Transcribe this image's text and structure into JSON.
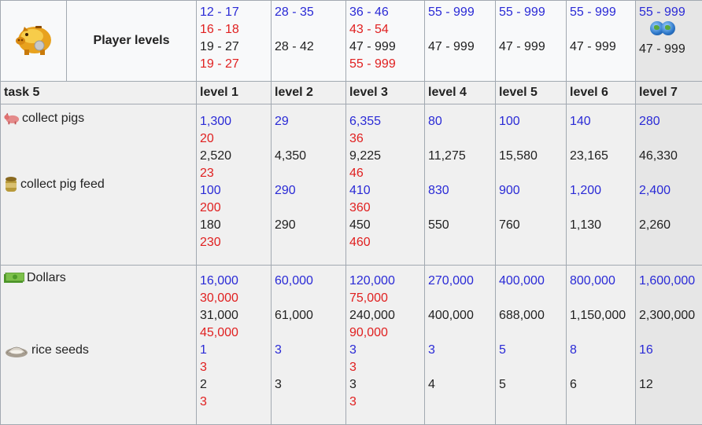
{
  "header": {
    "player_levels_label": "Player levels",
    "columns": [
      {
        "lines": [
          {
            "t": "12 - 17",
            "c": "blue"
          },
          {
            "t": "16 - 18",
            "c": "red"
          },
          {
            "t": "19 - 27",
            "c": "black"
          },
          {
            "t": "19 - 27",
            "c": "red"
          }
        ]
      },
      {
        "lines": [
          {
            "t": "28 - 35",
            "c": "blue"
          },
          {
            "t": "",
            "c": "gap"
          },
          {
            "t": "28 - 42",
            "c": "black"
          }
        ]
      },
      {
        "lines": [
          {
            "t": "36 - 46",
            "c": "blue"
          },
          {
            "t": "43 - 54",
            "c": "red"
          },
          {
            "t": "47 - 999",
            "c": "black"
          },
          {
            "t": "55 - 999",
            "c": "red"
          }
        ]
      },
      {
        "lines": [
          {
            "t": "55 - 999",
            "c": "blue"
          },
          {
            "t": "",
            "c": "gap"
          },
          {
            "t": "47 - 999",
            "c": "black"
          }
        ]
      },
      {
        "lines": [
          {
            "t": "55 - 999",
            "c": "blue"
          },
          {
            "t": "",
            "c": "gap"
          },
          {
            "t": "47 - 999",
            "c": "black"
          }
        ]
      },
      {
        "lines": [
          {
            "t": "55 - 999",
            "c": "blue"
          },
          {
            "t": "",
            "c": "gap"
          },
          {
            "t": "47 - 999",
            "c": "black"
          }
        ]
      },
      {
        "lines": [
          {
            "t": "55 - 999",
            "c": "blue"
          },
          {
            "t": "globe",
            "c": "globe"
          },
          {
            "t": "47 - 999",
            "c": "black"
          }
        ]
      }
    ]
  },
  "levels_row": {
    "task_label": "task 5",
    "levels": [
      "level 1",
      "level 2",
      "level 3",
      "level 4",
      "level 5",
      "level 6",
      "level 7"
    ]
  },
  "section_a": {
    "items": [
      {
        "label": "collect pigs",
        "icon": "pig-icon"
      },
      {
        "label": "collect pig feed",
        "icon": "pig-feed-icon"
      }
    ],
    "columns": [
      [
        {
          "t": "1,300",
          "c": "blue"
        },
        {
          "t": "20",
          "c": "red"
        },
        {
          "t": "2,520",
          "c": "black"
        },
        {
          "t": "23",
          "c": "red"
        },
        {
          "t": "100",
          "c": "blue"
        },
        {
          "t": "200",
          "c": "red"
        },
        {
          "t": "180",
          "c": "black"
        },
        {
          "t": "230",
          "c": "red"
        }
      ],
      [
        {
          "t": "29",
          "c": "blue"
        },
        {
          "t": "",
          "c": "gap"
        },
        {
          "t": "4,350",
          "c": "black"
        },
        {
          "t": "",
          "c": "gap"
        },
        {
          "t": "290",
          "c": "blue"
        },
        {
          "t": "",
          "c": "gap"
        },
        {
          "t": "290",
          "c": "black"
        }
      ],
      [
        {
          "t": "6,355",
          "c": "blue"
        },
        {
          "t": "36",
          "c": "red"
        },
        {
          "t": "9,225",
          "c": "black"
        },
        {
          "t": "46",
          "c": "red"
        },
        {
          "t": "410",
          "c": "blue"
        },
        {
          "t": "360",
          "c": "red"
        },
        {
          "t": "450",
          "c": "black"
        },
        {
          "t": "460",
          "c": "red"
        }
      ],
      [
        {
          "t": "80",
          "c": "blue"
        },
        {
          "t": "",
          "c": "gap"
        },
        {
          "t": "11,275",
          "c": "black"
        },
        {
          "t": "",
          "c": "gap"
        },
        {
          "t": "830",
          "c": "blue"
        },
        {
          "t": "",
          "c": "gap"
        },
        {
          "t": "550",
          "c": "black"
        }
      ],
      [
        {
          "t": "100",
          "c": "blue"
        },
        {
          "t": "",
          "c": "gap"
        },
        {
          "t": "15,580",
          "c": "black"
        },
        {
          "t": "",
          "c": "gap"
        },
        {
          "t": "900",
          "c": "blue"
        },
        {
          "t": "",
          "c": "gap"
        },
        {
          "t": "760",
          "c": "black"
        }
      ],
      [
        {
          "t": "140",
          "c": "blue"
        },
        {
          "t": "",
          "c": "gap"
        },
        {
          "t": "23,165",
          "c": "black"
        },
        {
          "t": "",
          "c": "gap"
        },
        {
          "t": "1,200",
          "c": "blue"
        },
        {
          "t": "",
          "c": "gap"
        },
        {
          "t": "1,130",
          "c": "black"
        }
      ],
      [
        {
          "t": "280",
          "c": "blue"
        },
        {
          "t": "",
          "c": "gap"
        },
        {
          "t": "46,330",
          "c": "black"
        },
        {
          "t": "",
          "c": "gap"
        },
        {
          "t": "2,400",
          "c": "blue"
        },
        {
          "t": "",
          "c": "gap"
        },
        {
          "t": "2,260",
          "c": "black"
        }
      ]
    ]
  },
  "section_b": {
    "items": [
      {
        "label": "Dollars",
        "icon": "dollar-icon"
      },
      {
        "label": "rice seeds",
        "icon": "rice-seeds-icon"
      }
    ],
    "columns": [
      [
        {
          "t": "16,000",
          "c": "blue"
        },
        {
          "t": "30,000",
          "c": "red"
        },
        {
          "t": "31,000",
          "c": "black"
        },
        {
          "t": "45,000",
          "c": "red"
        },
        {
          "t": "1",
          "c": "blue"
        },
        {
          "t": "3",
          "c": "red"
        },
        {
          "t": "2",
          "c": "black"
        },
        {
          "t": "3",
          "c": "red"
        }
      ],
      [
        {
          "t": "60,000",
          "c": "blue"
        },
        {
          "t": "",
          "c": "gap"
        },
        {
          "t": "61,000",
          "c": "black"
        },
        {
          "t": "",
          "c": "gap"
        },
        {
          "t": "3",
          "c": "blue"
        },
        {
          "t": "",
          "c": "gap"
        },
        {
          "t": "3",
          "c": "black"
        }
      ],
      [
        {
          "t": "120,000",
          "c": "blue"
        },
        {
          "t": "75,000",
          "c": "red"
        },
        {
          "t": "240,000",
          "c": "black"
        },
        {
          "t": "90,000",
          "c": "red"
        },
        {
          "t": "3",
          "c": "blue"
        },
        {
          "t": "3",
          "c": "red"
        },
        {
          "t": "3",
          "c": "black"
        },
        {
          "t": "3",
          "c": "red"
        }
      ],
      [
        {
          "t": "270,000",
          "c": "blue"
        },
        {
          "t": "",
          "c": "gap"
        },
        {
          "t": "400,000",
          "c": "black"
        },
        {
          "t": "",
          "c": "gap"
        },
        {
          "t": "3",
          "c": "blue"
        },
        {
          "t": "",
          "c": "gap"
        },
        {
          "t": "4",
          "c": "black"
        }
      ],
      [
        {
          "t": "400,000",
          "c": "blue"
        },
        {
          "t": "",
          "c": "gap"
        },
        {
          "t": "688,000",
          "c": "black"
        },
        {
          "t": "",
          "c": "gap"
        },
        {
          "t": "5",
          "c": "blue"
        },
        {
          "t": "",
          "c": "gap"
        },
        {
          "t": "5",
          "c": "black"
        }
      ],
      [
        {
          "t": "800,000",
          "c": "blue"
        },
        {
          "t": "",
          "c": "gap"
        },
        {
          "t": "1,150,000",
          "c": "black"
        },
        {
          "t": "",
          "c": "gap"
        },
        {
          "t": "8",
          "c": "blue"
        },
        {
          "t": "",
          "c": "gap"
        },
        {
          "t": "6",
          "c": "black"
        }
      ],
      [
        {
          "t": "1,600,000",
          "c": "blue"
        },
        {
          "t": "",
          "c": "gap"
        },
        {
          "t": "2,300,000",
          "c": "black"
        },
        {
          "t": "",
          "c": "gap"
        },
        {
          "t": "16",
          "c": "blue"
        },
        {
          "t": "",
          "c": "gap"
        },
        {
          "t": "12",
          "c": "black"
        }
      ]
    ]
  }
}
